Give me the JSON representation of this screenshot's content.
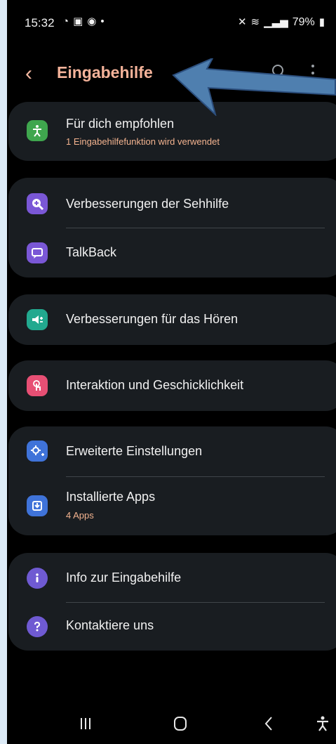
{
  "status_bar": {
    "time": "15:32",
    "battery": "79%",
    "left_icons": [
      "whatsapp-icon",
      "gallery-icon",
      "facebook-icon",
      "dot-icon"
    ],
    "right_icons": [
      "mute-icon",
      "wifi-icon",
      "signal-icon",
      "battery-icon"
    ]
  },
  "header": {
    "title": "Eingabehilfe",
    "accent_color": "#f5b39a"
  },
  "sections": [
    {
      "items": [
        {
          "icon": "accessibility-icon",
          "title": "Für dich empfohlen",
          "subtitle": "1 Eingabehilfefunktion wird verwendet",
          "icon_color": "#3fa64e"
        }
      ]
    },
    {
      "items": [
        {
          "icon": "vision-enhancement-icon",
          "title": "Verbesserungen der Sehhilfe",
          "icon_color": "#7a57d6"
        },
        {
          "icon": "talkback-icon",
          "title": "TalkBack",
          "icon_color": "#7a57d6"
        }
      ]
    },
    {
      "items": [
        {
          "icon": "hearing-enhancement-icon",
          "title": "Verbesserungen für das Hören",
          "icon_color": "#22a98f"
        }
      ]
    },
    {
      "items": [
        {
          "icon": "interaction-icon",
          "title": "Interaktion und Geschicklichkeit",
          "icon_color": "#e74f74"
        }
      ]
    },
    {
      "items": [
        {
          "icon": "advanced-settings-icon",
          "title": "Erweiterte Einstellungen",
          "icon_color": "#3f73d9"
        },
        {
          "icon": "installed-apps-icon",
          "title": "Installierte Apps",
          "subtitle": "4 Apps",
          "icon_color": "#3f73d9"
        }
      ]
    },
    {
      "items": [
        {
          "icon": "info-icon",
          "title": "Info zur Eingabehilfe",
          "icon_color": "#6f5ad2"
        },
        {
          "icon": "contact-icon",
          "title": "Kontaktiere uns",
          "icon_color": "#6f5ad2"
        }
      ]
    }
  ],
  "navigation": {
    "icons": [
      "recent-apps-icon",
      "home-icon",
      "back-nav-icon",
      "accessibility-shortcut-icon"
    ]
  }
}
